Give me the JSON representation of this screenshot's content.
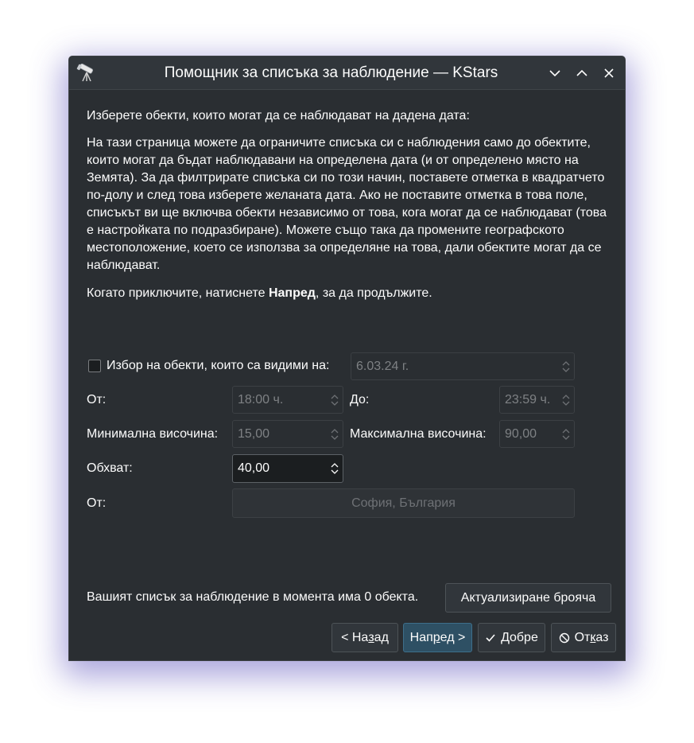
{
  "window": {
    "title": "Помощник за списъка за наблюдение — KStars"
  },
  "intro": {
    "heading": "Изберете обекти, които могат да се наблюдават на дадена дата:",
    "body": "На тази страница можете да ограничите списъка си с наблюдения само до обектите, които могат да бъдат наблюдавани на определена дата (и от определено място на Земята). За да филтрирате списъка си по този начин, поставете отметка в квадратчето по-долу и след това изберете желаната дата. Ако не поставите отметка в това поле, списъкът ви ще включва обекти независимо от това, кога могат да се наблюдават (това е настройката по подразбиране). Можете също така да промените географското местоположение, което се използва за определяне на това, дали обектите могат да се наблюдават.",
    "finish_prefix": "Когато приключите, натиснете ",
    "finish_bold": "Напред",
    "finish_suffix": ", за да продължите."
  },
  "form": {
    "visible_checkbox_label": "Избор на обекти, които са видими на:",
    "visible_checked": false,
    "date_value": "6.03.24 г.",
    "from_label": "От:",
    "from_value": "18:00 ч.",
    "to_label": "До:",
    "to_value": "23:59 ч.",
    "min_alt_label": "Минимална височина:",
    "min_alt_value": "15,00",
    "max_alt_label": "Максимална височина:",
    "max_alt_value": "90,00",
    "range_label": "Обхват:",
    "range_value": "40,00",
    "location_label": "От:",
    "location_value": "София, България"
  },
  "footer": {
    "count_text": "Вашият списък за наблюдение в момента има 0 обекта.",
    "refresh_button": "Актуализиране брояча"
  },
  "buttons": {
    "back": {
      "pre": "< На",
      "mnemonic": "з",
      "post": "ад"
    },
    "next": {
      "pre": "Нап",
      "mnemonic": "р",
      "post": "ед >"
    },
    "ok": {
      "pre": "",
      "mnemonic": "Д",
      "post": "обре"
    },
    "cancel": {
      "pre": "От",
      "mnemonic": "к",
      "post": "аз"
    }
  },
  "colors": {
    "background": "#2a2e32",
    "titlebar": "#31363b",
    "primary_button": "#2e5064",
    "text": "#fcfcfc",
    "disabled_text": "#7e8184"
  }
}
